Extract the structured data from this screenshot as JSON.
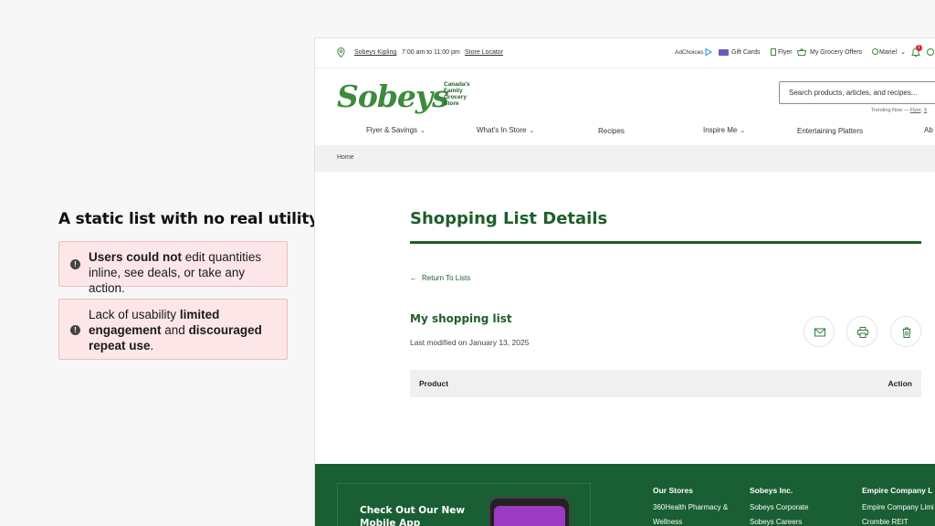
{
  "annotation": {
    "title": "A static list with no real utility",
    "card1": {
      "bold": "Users could not",
      "rest": " edit quantities inline, see deals, or take any action."
    },
    "card2": {
      "pre": "Lack of usability ",
      "bold1": "limited engagement",
      "mid": " and ",
      "bold2": "discouraged repeat use",
      "post": "."
    }
  },
  "topbar": {
    "store": "Sobeys Kipling",
    "hours": "7:00 am to 11:00 pm",
    "locator": "Store Locator",
    "adchoices": "AdChoices",
    "giftcards": "Gift Cards",
    "flyer": "Flyer",
    "offers": "My Grocery Offers",
    "user": "Mariel",
    "notif_count": "1"
  },
  "header": {
    "logo": "Sobeys",
    "tagline": "Canada's Family Grocery Store",
    "search_placeholder": "Search products, articles, and recipes...",
    "trending_label": "Trending Now —",
    "trending_links": [
      "Flyer",
      "S"
    ]
  },
  "nav": [
    "Flyer & Savings",
    "What's In Store",
    "Recipes",
    "Inspire Me",
    "Entertaining Platters",
    "Ab"
  ],
  "breadcrumb": "Home",
  "main": {
    "title": "Shopping List Details",
    "return": "Return To Lists",
    "list_name": "My shopping list",
    "modified": "Last modified on January 13, 2025",
    "table": {
      "product": "Product",
      "action": "Action"
    }
  },
  "footer": {
    "app_title": "Check Out Our New Mobile App",
    "col1": {
      "head": "Our Stores",
      "links": [
        "360Health Pharmacy &",
        "Wellness"
      ]
    },
    "col2": {
      "head": "Sobeys Inc.",
      "links": [
        "Sobeys Corporate",
        "Sobeys Careers"
      ]
    },
    "col3": {
      "head": "Empire Company L",
      "links": [
        "Empire Company Limi",
        "Crombie REIT"
      ]
    }
  },
  "colors": {
    "brand_green": "#1f5e2a",
    "logo_green": "#3c8a3c",
    "footer_green": "#1a5e34",
    "alert_pink": "#fde6e8"
  }
}
